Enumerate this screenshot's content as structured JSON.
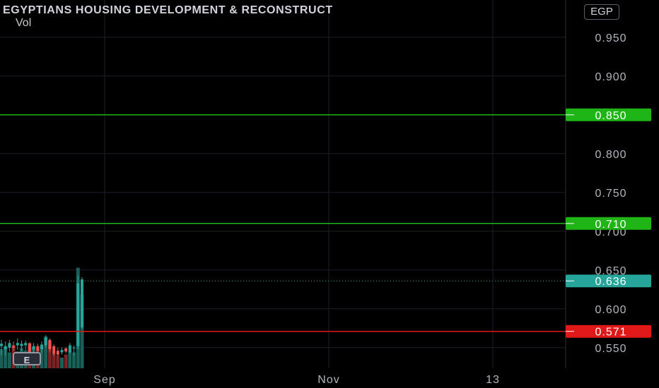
{
  "header": {
    "title": "EGYPTIANS HOUSING DEVELOPMENT & RECONSTRUCT",
    "vol_label": "Vol",
    "currency": "EGP"
  },
  "badges": {
    "earnings": "E"
  },
  "colors": {
    "background": "#000000",
    "grid": "#1c1f27",
    "text": "#d1d4dc",
    "up": "#26a69a",
    "down": "#ef5350",
    "green_level": "#1fb517",
    "red_level": "#e01818"
  },
  "chart_data": {
    "type": "candlestick",
    "y_axis": {
      "min": 0.505,
      "max": 0.968,
      "ticks": [
        "0.550",
        "0.600",
        "0.650",
        "0.700",
        "0.750",
        "0.800",
        "0.850",
        "0.900",
        "0.950"
      ]
    },
    "x_axis": {
      "labels": [
        "Sep",
        "Nov",
        "13"
      ]
    },
    "price_lines": [
      {
        "value": 0.85,
        "label": "0.850",
        "color": "#1fb517",
        "style": "solid"
      },
      {
        "value": 0.71,
        "label": "0.710",
        "color": "#1fb517",
        "style": "solid"
      },
      {
        "value": 0.636,
        "label": "0.636",
        "color": "#26a69a",
        "style": "dotted"
      },
      {
        "value": 0.571,
        "label": "0.571",
        "color": "#e01818",
        "style": "solid"
      }
    ],
    "candles": [
      {
        "o": 0.552,
        "h": 0.56,
        "l": 0.54,
        "c": 0.555
      },
      {
        "o": 0.548,
        "h": 0.558,
        "l": 0.54,
        "c": 0.552
      },
      {
        "o": 0.55,
        "h": 0.56,
        "l": 0.545,
        "c": 0.556
      },
      {
        "o": 0.552,
        "h": 0.558,
        "l": 0.546,
        "c": 0.55
      },
      {
        "o": 0.553,
        "h": 0.562,
        "l": 0.547,
        "c": 0.556
      },
      {
        "o": 0.552,
        "h": 0.559,
        "l": 0.546,
        "c": 0.555
      },
      {
        "o": 0.553,
        "h": 0.559,
        "l": 0.547,
        "c": 0.556
      },
      {
        "o": 0.555,
        "h": 0.557,
        "l": 0.54,
        "c": 0.543
      },
      {
        "o": 0.548,
        "h": 0.556,
        "l": 0.543,
        "c": 0.552
      },
      {
        "o": 0.552,
        "h": 0.555,
        "l": 0.542,
        "c": 0.546
      },
      {
        "o": 0.548,
        "h": 0.558,
        "l": 0.543,
        "c": 0.554
      },
      {
        "o": 0.553,
        "h": 0.566,
        "l": 0.55,
        "c": 0.563
      },
      {
        "o": 0.56,
        "h": 0.562,
        "l": 0.544,
        "c": 0.548
      },
      {
        "o": 0.552,
        "h": 0.554,
        "l": 0.539,
        "c": 0.542
      },
      {
        "o": 0.546,
        "h": 0.55,
        "l": 0.539,
        "c": 0.541
      },
      {
        "o": 0.544,
        "h": 0.55,
        "l": 0.541,
        "c": 0.547
      },
      {
        "o": 0.549,
        "h": 0.551,
        "l": 0.543,
        "c": 0.545
      },
      {
        "o": 0.544,
        "h": 0.556,
        "l": 0.542,
        "c": 0.553
      },
      {
        "o": 0.55,
        "h": 0.553,
        "l": 0.54,
        "c": 0.55
      },
      {
        "o": 0.552,
        "h": 0.643,
        "l": 0.548,
        "c": 0.633
      },
      {
        "o": 0.576,
        "h": 0.641,
        "l": 0.574,
        "c": 0.638
      }
    ],
    "volume": [
      18,
      20,
      15,
      22,
      16,
      19,
      17,
      24,
      20,
      18,
      21,
      30,
      26,
      14,
      12,
      10,
      13,
      16,
      15,
      95,
      70
    ],
    "volume_max": 100
  }
}
